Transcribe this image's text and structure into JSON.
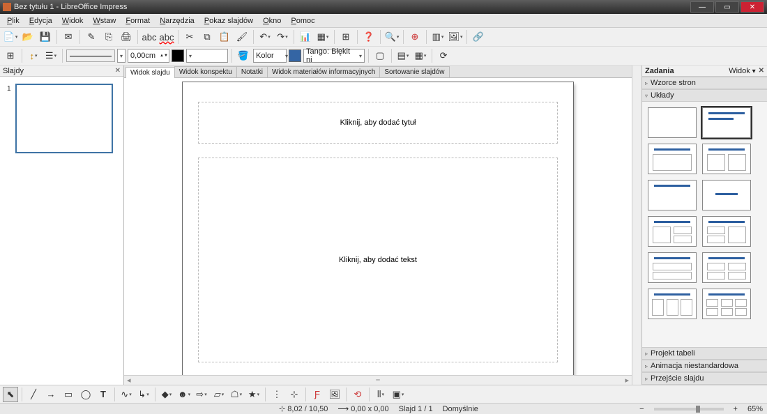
{
  "window": {
    "title": "Bez tytułu 1 - LibreOffice Impress"
  },
  "menu": [
    "Plik",
    "Edycja",
    "Widok",
    "Wstaw",
    "Format",
    "Narzędzia",
    "Pokaz slajdów",
    "Okno",
    "Pomoc"
  ],
  "toolbar1_tips": [
    "new",
    "open",
    "save",
    "sep",
    "mail",
    "sep",
    "edit",
    "pdf",
    "print",
    "sep",
    "spellcheck",
    "abc",
    "sep",
    "cut",
    "copy",
    "paste",
    "paint-format",
    "sep",
    "undo",
    "redo",
    "sep",
    "chart",
    "table",
    "sep",
    "grid",
    "sep",
    "help",
    "sep",
    "zoom",
    "sep",
    "nav",
    "sep",
    "gallery",
    "picture",
    "sep",
    "link"
  ],
  "toolbar2": {
    "line_width": "0,00cm",
    "color_label": "Kolor",
    "color_name": "Tango: Błękit ni",
    "color_hex": "#3465a4"
  },
  "slides_panel": {
    "title": "Slajdy",
    "slide_num": "1"
  },
  "view_tabs": [
    "Widok slajdu",
    "Widok konspektu",
    "Notatki",
    "Widok materiałów informacyjnych",
    "Sortowanie slajdów"
  ],
  "slide": {
    "title_ph": "Kliknij, aby dodać tytuł",
    "body_ph": "Kliknij, aby dodać tekst"
  },
  "tasks": {
    "title": "Zadania",
    "view_label": "Widok",
    "sections": [
      "Wzorce stron",
      "Układy",
      "Projekt tabeli",
      "Animacja niestandardowa",
      "Przejście slajdu"
    ]
  },
  "status": {
    "pos": "8,02 / 10,50",
    "size": "0,00 x 0,00",
    "page": "Slajd 1 / 1",
    "style": "Domyślnie",
    "zoom": "65%"
  }
}
